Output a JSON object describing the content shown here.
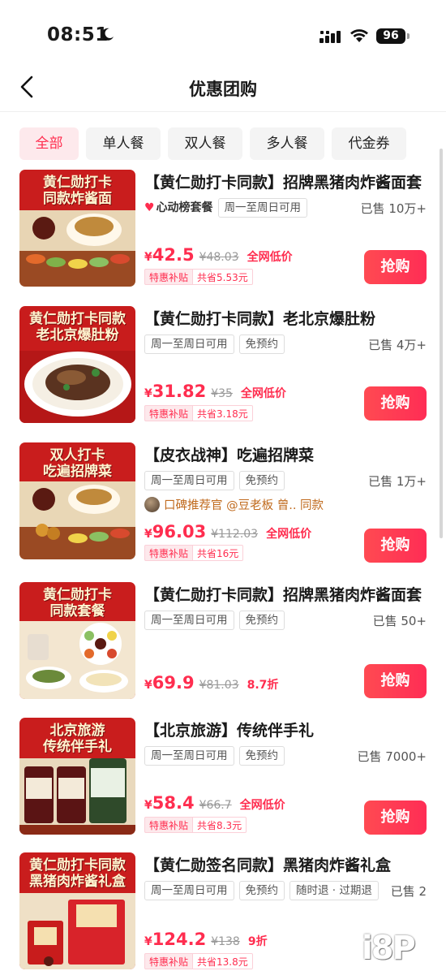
{
  "status_bar": {
    "time": "08:51",
    "battery": "96"
  },
  "nav": {
    "title": "优惠团购"
  },
  "tabs": [
    "全部",
    "单人餐",
    "双人餐",
    "多人餐",
    "代金券"
  ],
  "deals": [
    {
      "thumb_lines": [
        "黄仁勋打卡",
        "同款炸酱面"
      ],
      "title": "【黄仁勋打卡同款】招牌黑猪肉炸酱面套",
      "hot_tag": "心动榜套餐",
      "tags": [
        "周一至周日可用"
      ],
      "sold": "已售 10万+",
      "price_yen": "¥",
      "price": "42.5",
      "orig_price": "¥48.03",
      "promo": "全网低价",
      "subsidy": "特惠补贴",
      "saving": "共省5.53元",
      "buy": "抢购"
    },
    {
      "thumb_lines": [
        "黄仁勋打卡同款",
        "老北京爆肚粉"
      ],
      "title": "【黄仁勋打卡同款】老北京爆肚粉",
      "tags": [
        "周一至周日可用",
        "免预约"
      ],
      "sold": "已售 4万+",
      "price_yen": "¥",
      "price": "31.82",
      "orig_price": "¥35",
      "promo": "全网低价",
      "subsidy": "特惠补贴",
      "saving": "共省3.18元",
      "buy": "抢购"
    },
    {
      "thumb_lines": [
        "双人打卡",
        "吃遍招牌菜"
      ],
      "title": "【皮衣战神】吃遍招牌菜",
      "tags": [
        "周一至周日可用",
        "免预约"
      ],
      "sold": "已售 1万+",
      "reco": "口碑推荐官 @豆老板 曾.. 同款",
      "price_yen": "¥",
      "price": "96.03",
      "orig_price": "¥112.03",
      "promo": "全网低价",
      "subsidy": "特惠补贴",
      "saving": "共省16元",
      "buy": "抢购"
    },
    {
      "thumb_lines": [
        "黄仁勋打卡",
        "同款套餐"
      ],
      "title": "【黄仁勋打卡同款】招牌黑猪肉炸酱面套",
      "tags": [
        "周一至周日可用",
        "免预约"
      ],
      "sold": "已售 50+",
      "price_yen": "¥",
      "price": "69.9",
      "orig_price": "¥81.03",
      "promo": "8.7折",
      "buy": "抢购"
    },
    {
      "thumb_lines": [
        "北京旅游",
        "传统伴手礼"
      ],
      "title": "【北京旅游】传统伴手礼",
      "tags": [
        "周一至周日可用",
        "免预约"
      ],
      "sold": "已售 7000+",
      "price_yen": "¥",
      "price": "58.4",
      "orig_price": "¥66.7",
      "promo": "全网低价",
      "subsidy": "特惠补贴",
      "saving": "共省8.3元",
      "buy": "抢购"
    },
    {
      "thumb_lines": [
        "黄仁勋打卡同款",
        "黑猪肉炸酱礼盒"
      ],
      "title": "【黄仁勋签名同款】黑猪肉炸酱礼盒",
      "tags": [
        "周一至周日可用",
        "免预约",
        "随时退 · 过期退"
      ],
      "sold": "已售 2",
      "price_yen": "¥",
      "price": "124.2",
      "orig_price": "¥138",
      "promo": "9折",
      "subsidy": "特惠补贴",
      "saving": "共省13.8元"
    }
  ],
  "icons": {
    "moon": "moon-icon",
    "signal": "cellular-signal-icon",
    "wifi": "wifi-icon",
    "back": "chevron-left-icon"
  },
  "colors": {
    "accent": "#ff2d4f",
    "tab_active_bg": "#fde9ec",
    "promo_orange": "#c06a1d"
  }
}
